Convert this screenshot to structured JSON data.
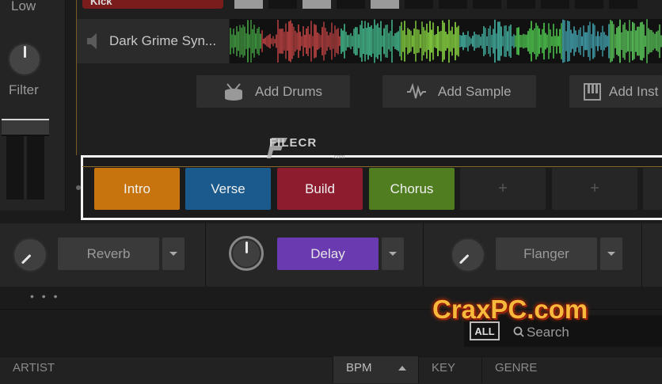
{
  "mixer": {
    "eq_label": "Low",
    "filter_label": "Filter"
  },
  "tracks": {
    "kick_label": "Kick",
    "synth_name": "Dark Grime Syn..."
  },
  "add_buttons": {
    "drums": "Add Drums",
    "sample": "Add Sample",
    "instrument": "Add Inst"
  },
  "pads": [
    {
      "label": "Intro",
      "color": "#c8740e"
    },
    {
      "label": "Verse",
      "color": "#1a5a8c"
    },
    {
      "label": "Build",
      "color": "#8c1c2e"
    },
    {
      "label": "Chorus",
      "color": "#4f7d1f"
    },
    {
      "label": "+",
      "color": "#262626"
    },
    {
      "label": "+",
      "color": "#262626"
    }
  ],
  "fx": {
    "reverb": "Reverb",
    "delay": "Delay",
    "delay_color": "#6a3bb0",
    "flanger": "Flanger"
  },
  "browser": {
    "more": "• • •",
    "all_label": "ALL",
    "search_placeholder": "Search",
    "columns": [
      "ARTIST",
      "BPM",
      "KEY",
      "GENRE"
    ]
  },
  "watermarks": {
    "filecr": "FILECR",
    "filecr_sub": ".com",
    "craxpc": "CraxPC.com"
  },
  "colors": {
    "accent_orange": "#c8740e",
    "kick_red": "#7a1b1c",
    "pad_frame": "#f2f2f2"
  }
}
